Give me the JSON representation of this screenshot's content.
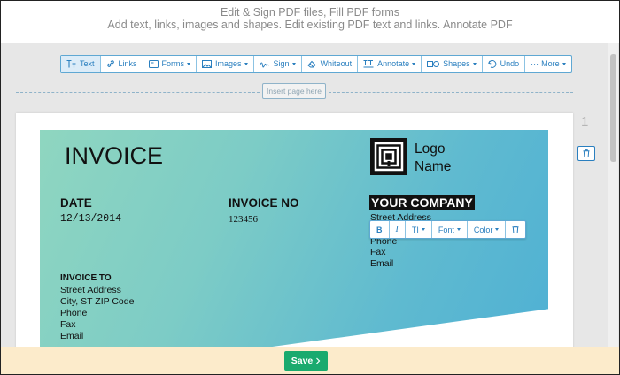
{
  "header": {
    "line1": "Edit & Sign PDF files, Fill PDF forms",
    "line2": "Add text, links, images and shapes. Edit existing PDF text and links. Annotate PDF"
  },
  "toolbar": {
    "text": "Text",
    "links": "Links",
    "forms": "Forms",
    "images": "Images",
    "sign": "Sign",
    "whiteout": "Whiteout",
    "annotate": "Annotate",
    "shapes": "Shapes",
    "undo": "Undo",
    "more": "More"
  },
  "insert_page": "Insert page here",
  "page_number": "1",
  "invoice": {
    "title": "INVOICE",
    "date_label": "DATE",
    "date_value": "12/13/2014",
    "invoice_no_label": "INVOICE NO",
    "invoice_no_value": "123456",
    "logo_line1": "Logo",
    "logo_line2": "Name",
    "company": "YOUR COMPANY",
    "company_address": "Street Address",
    "company_phone": "Phone",
    "company_fax": "Fax",
    "company_email": "Email",
    "invoice_to_label": "INVOICE TO",
    "to_address": "Street Address",
    "to_city": "City, ST ZIP Code",
    "to_phone": "Phone",
    "to_fax": "Fax",
    "to_email": "Email"
  },
  "format_toolbar": {
    "bold": "B",
    "italic": "I",
    "size": "TI",
    "font": "Font",
    "color": "Color"
  },
  "save_button": "Save",
  "colors": {
    "accent": "#2a7fbf",
    "save": "#1aaa6e",
    "footer": "#fcebcb"
  }
}
